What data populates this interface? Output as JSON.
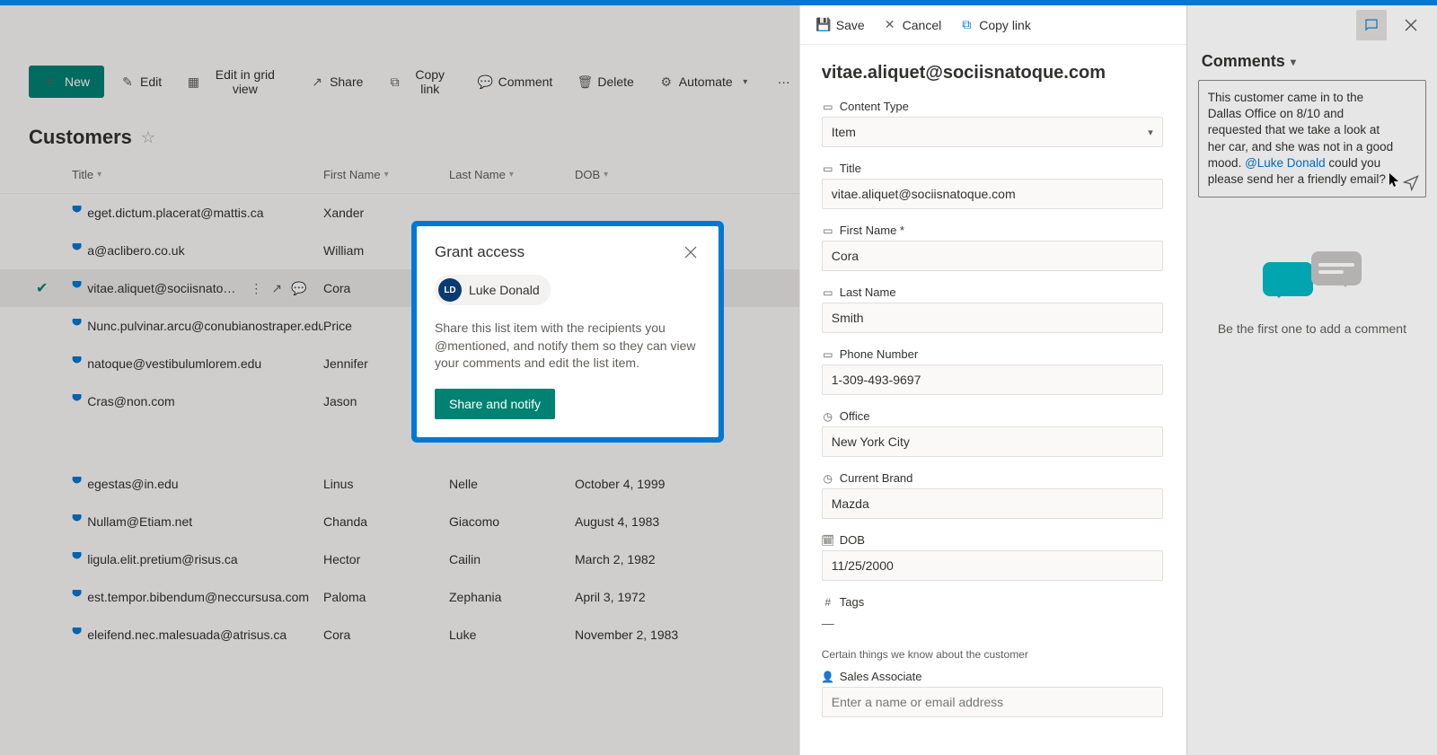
{
  "toolbar": {
    "new": "New",
    "edit": "Edit",
    "gridEdit": "Edit in grid view",
    "share": "Share",
    "copyLink": "Copy link",
    "comment": "Comment",
    "delete": "Delete",
    "automate": "Automate"
  },
  "list": {
    "title": "Customers",
    "columns": {
      "title": "Title",
      "firstName": "First Name",
      "lastName": "Last Name",
      "dob": "DOB"
    },
    "rows": [
      {
        "title": "eget.dictum.placerat@mattis.ca",
        "firstName": "Xander",
        "lastName": "",
        "dob": ""
      },
      {
        "title": "a@aclibero.co.uk",
        "firstName": "William",
        "lastName": "",
        "dob": ""
      },
      {
        "title": "vitae.aliquet@sociisnato…",
        "firstName": "Cora",
        "lastName": "",
        "dob": "",
        "selected": true
      },
      {
        "title": "Nunc.pulvinar.arcu@conubianostraper.edu",
        "firstName": "Price",
        "lastName": "",
        "dob": ""
      },
      {
        "title": "natoque@vestibulumlorem.edu",
        "firstName": "Jennifer",
        "lastName": "",
        "dob": ""
      },
      {
        "title": "Cras@non.com",
        "firstName": "Jason",
        "lastName": "",
        "dob": ""
      },
      {
        "title": "",
        "firstName": "",
        "lastName": "",
        "dob": "",
        "blank": true
      },
      {
        "title": "egestas@in.edu",
        "firstName": "Linus",
        "lastName": "Nelle",
        "dob": "October 4, 1999"
      },
      {
        "title": "Nullam@Etiam.net",
        "firstName": "Chanda",
        "lastName": "Giacomo",
        "dob": "August 4, 1983"
      },
      {
        "title": "ligula.elit.pretium@risus.ca",
        "firstName": "Hector",
        "lastName": "Cailin",
        "dob": "March 2, 1982"
      },
      {
        "title": "est.tempor.bibendum@neccursusa.com",
        "firstName": "Paloma",
        "lastName": "Zephania",
        "dob": "April 3, 1972"
      },
      {
        "title": "eleifend.nec.malesuada@atrisus.ca",
        "firstName": "Cora",
        "lastName": "Luke",
        "dob": "November 2, 1983"
      }
    ]
  },
  "details": {
    "toolbar": {
      "save": "Save",
      "cancel": "Cancel",
      "copyLink": "Copy link"
    },
    "title": "vitae.aliquet@sociisnatoque.com",
    "fields": {
      "contentType": {
        "label": "Content Type",
        "value": "Item"
      },
      "titleF": {
        "label": "Title",
        "value": "vitae.aliquet@sociisnatoque.com"
      },
      "firstName": {
        "label": "First Name *",
        "value": "Cora"
      },
      "lastName": {
        "label": "Last Name",
        "value": "Smith"
      },
      "phone": {
        "label": "Phone Number",
        "value": "1-309-493-9697"
      },
      "office": {
        "label": "Office",
        "value": "New York City"
      },
      "brand": {
        "label": "Current Brand",
        "value": "Mazda"
      },
      "dob": {
        "label": "DOB",
        "value": "11/25/2000"
      },
      "tags": {
        "label": "Tags",
        "value": "—"
      },
      "section": "Certain things we know about the customer",
      "salesAssoc": {
        "label": "Sales Associate",
        "placeholder": "Enter a name or email address"
      }
    }
  },
  "comments": {
    "title": "Comments",
    "boxTextPre": "This customer came in to the Dallas Office on 8/10 and requested that we take a look at her car, and she was not in a good mood. ",
    "mention": "@Luke Donald",
    "boxTextPost": " could you please send her a friendly email?",
    "empty": "Be the first one to add a comment"
  },
  "modal": {
    "title": "Grant access",
    "person": {
      "initials": "LD",
      "name": "Luke Donald"
    },
    "description": "Share this list item with the recipients you @mentioned, and notify them so they can view your comments and edit the list item.",
    "primary": "Share and notify"
  }
}
